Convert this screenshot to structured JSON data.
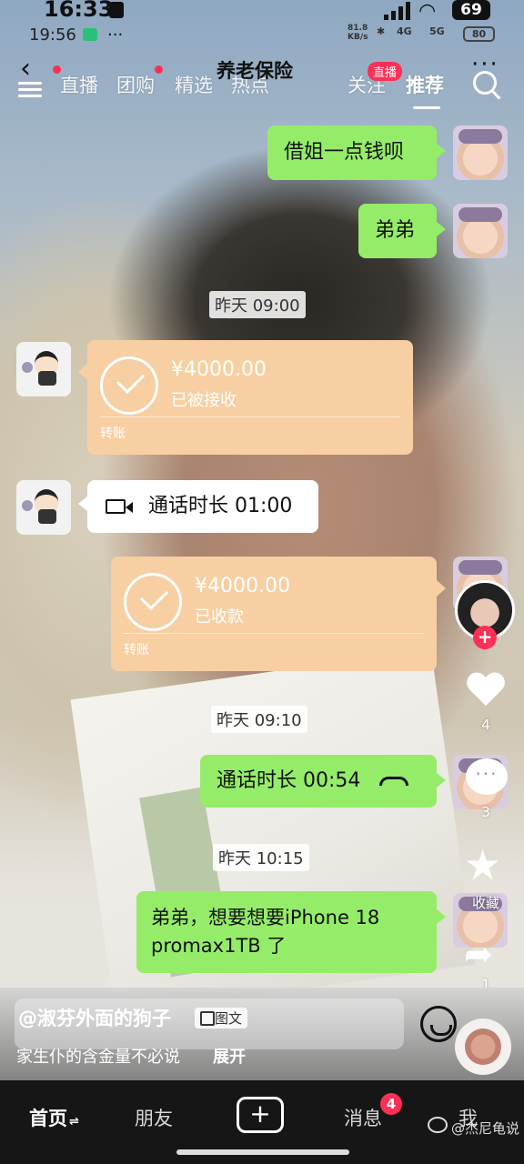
{
  "status_bar": {
    "time_main": "16:33",
    "time_overlay": "19:56",
    "overlay_dots": "···",
    "battery_main": "69",
    "net_speed_value": "81.8",
    "net_speed_unit": "KB/s",
    "sig1": "4G",
    "sig2": "5G",
    "battery_overlay": "80"
  },
  "chat_header": {
    "title": "养老保险",
    "more": "···"
  },
  "feed_tabs": {
    "items": [
      "直播",
      "团购",
      "精选",
      "热点",
      "",
      "关注",
      "推荐"
    ],
    "live_badge": "直播",
    "active": "推荐"
  },
  "messages": {
    "m1_text": "借姐一点钱呗",
    "m2_text": "弟弟",
    "ts1": "昨天 09:00",
    "tf1_amount": "¥4000.00",
    "tf1_status": "已被接收",
    "tf1_label": "转账",
    "call1_text": "通话时长 01:00",
    "tf2_amount": "¥4000.00",
    "tf2_status": "已收款",
    "tf2_label": "转账",
    "ts2": "昨天 09:10",
    "call2_text": "通话时长 00:54",
    "ts3": "昨天 10:15",
    "m3_text": "弟弟，想要想要iPhone 18 promax1TB 了"
  },
  "rail": {
    "like_count": "4",
    "comment_count": "3",
    "fav_label": "收藏",
    "share_count": "1",
    "comment_dots": "···"
  },
  "post_info": {
    "author": "@淑芬外面的狗子",
    "tag": "图文",
    "caption": "家生仆的含金量不必说",
    "expand": "展开"
  },
  "bottom_nav": {
    "home": "首页",
    "home_suffix": "⇌",
    "friends": "朋友",
    "add": "+",
    "messages": "消息",
    "messages_badge": "4",
    "me": "我",
    "watermark": "@杰尼龟说"
  }
}
